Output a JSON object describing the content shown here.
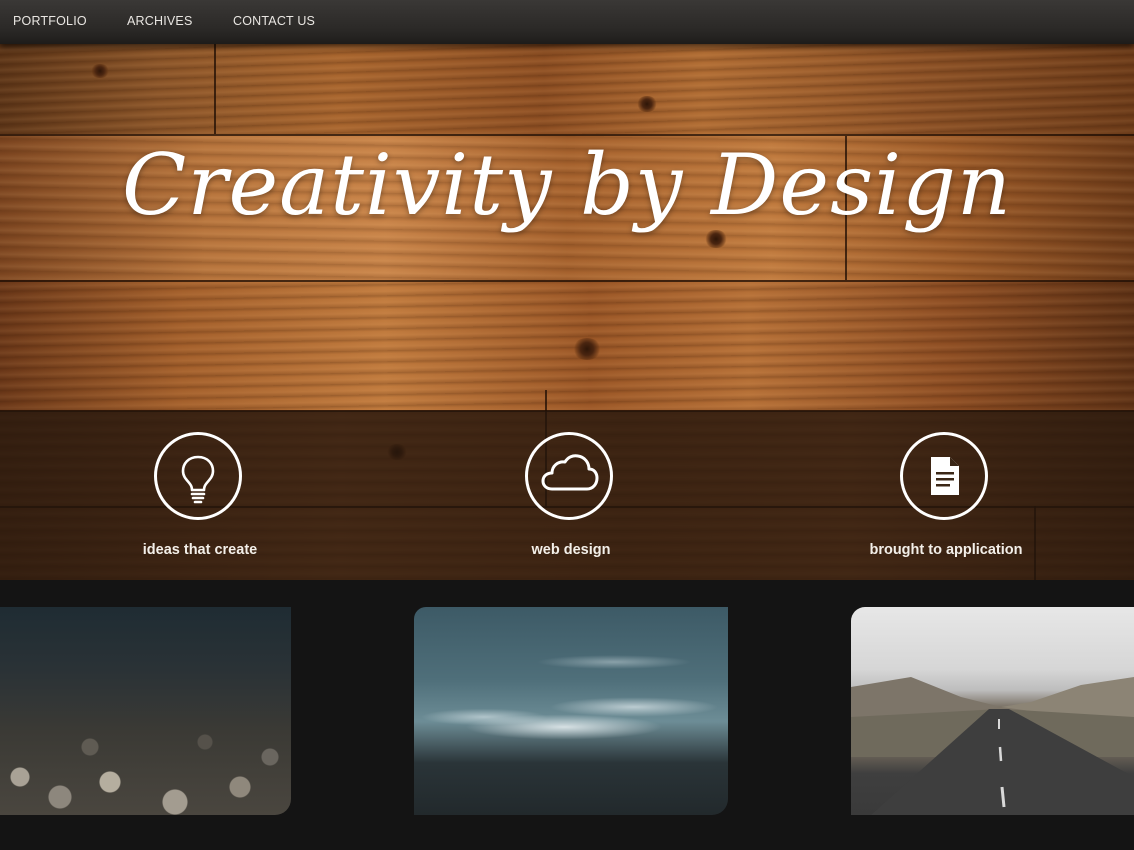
{
  "nav": {
    "items": [
      {
        "label": "PORTFOLIO"
      },
      {
        "label": "ARCHIVES"
      },
      {
        "label": "CONTACT US"
      }
    ]
  },
  "hero": {
    "title": "Creativity by Design"
  },
  "features": [
    {
      "label": "ideas that create",
      "icon": "lightbulb-icon"
    },
    {
      "label": "web design",
      "icon": "cloud-icon"
    },
    {
      "label": "brought to application",
      "icon": "document-icon"
    }
  ],
  "thumbnails": [
    {
      "subject": "pebbles-underwater-photo"
    },
    {
      "subject": "ocean-waves-photo"
    },
    {
      "subject": "mountain-road-photo"
    }
  ]
}
